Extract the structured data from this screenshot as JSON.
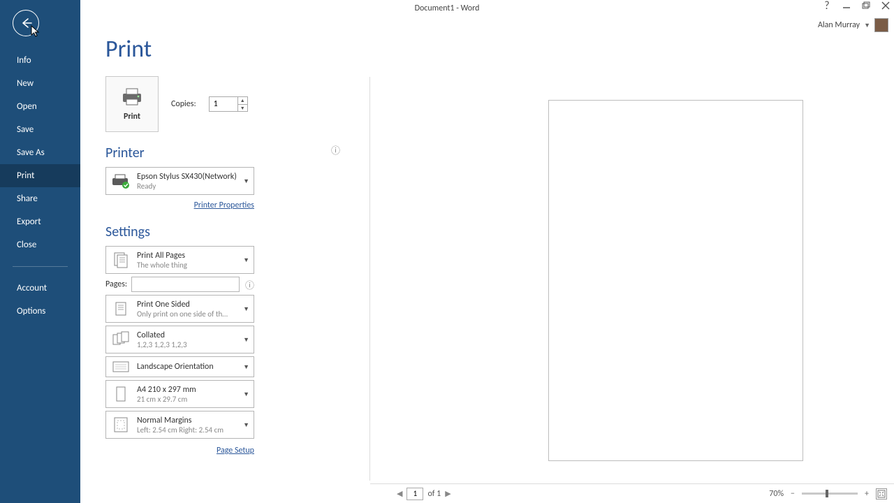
{
  "titlebar": {
    "title": "Document1 - Word"
  },
  "user": {
    "name": "Alan Murray"
  },
  "sidebar": {
    "items": [
      "Info",
      "New",
      "Open",
      "Save",
      "Save As",
      "Print",
      "Share",
      "Export",
      "Close"
    ],
    "bottom": [
      "Account",
      "Options"
    ],
    "active": "Print"
  },
  "page": {
    "title": "Print"
  },
  "print": {
    "button_label": "Print",
    "copies_label": "Copies:",
    "copies_value": "1"
  },
  "printer": {
    "heading": "Printer",
    "name": "Epson Stylus SX430(Network)",
    "status": "Ready",
    "properties_link": "Printer Properties"
  },
  "settings": {
    "heading": "Settings",
    "print_what": {
      "title": "Print All Pages",
      "sub": "The whole thing"
    },
    "pages_label": "Pages:",
    "pages_value": "",
    "sides": {
      "title": "Print One Sided",
      "sub": "Only print on one side of th…"
    },
    "collate": {
      "title": "Collated",
      "sub": "1,2,3    1,2,3    1,2,3"
    },
    "orientation": {
      "title": "Landscape Orientation"
    },
    "paper": {
      "title": "A4 210 x 297 mm",
      "sub": "21 cm x 29.7 cm"
    },
    "margins": {
      "title": "Normal Margins",
      "sub": "Left:  2.54 cm    Right:  2.54 cm"
    },
    "page_setup_link": "Page Setup"
  },
  "statusbar": {
    "page_current": "1",
    "page_total": "of 1",
    "zoom": "70%"
  }
}
